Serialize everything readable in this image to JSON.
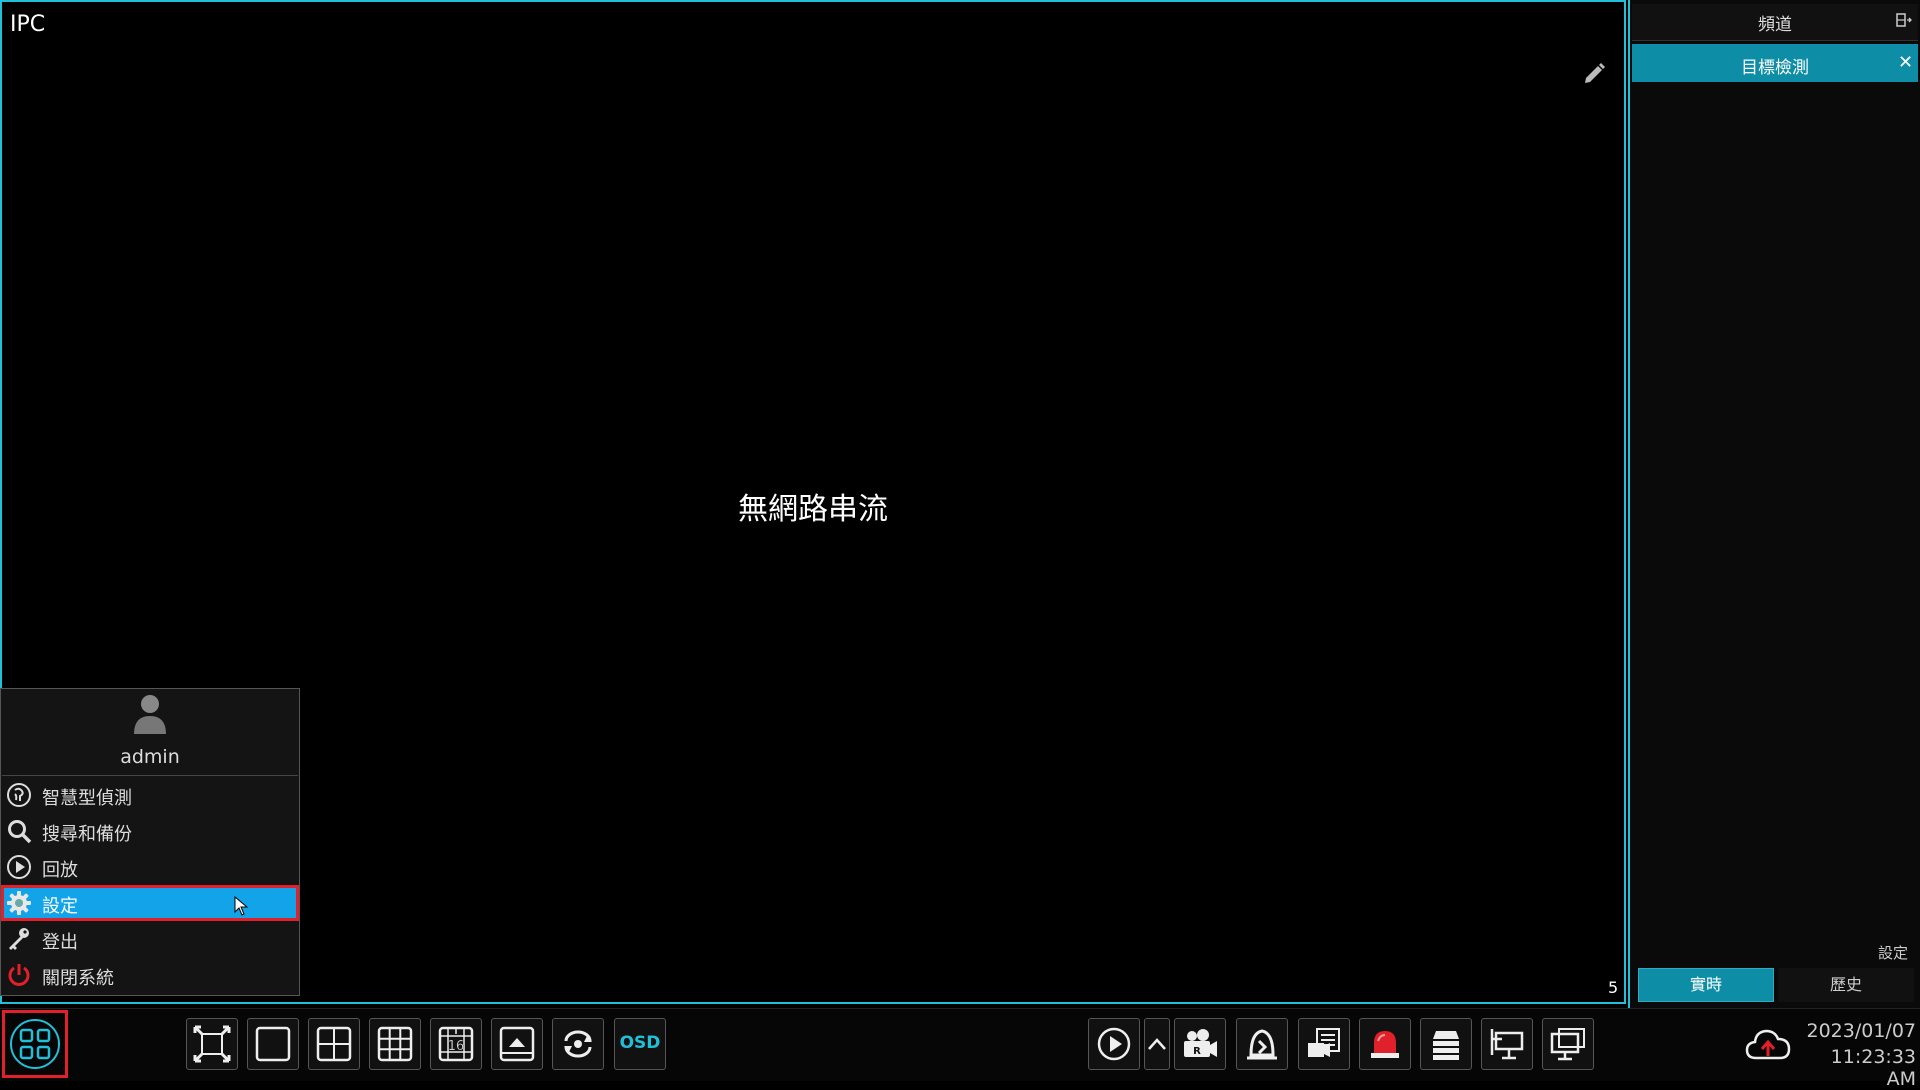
{
  "video": {
    "channel_name": "IPC",
    "status_text": "無網路串流",
    "channel_number": "5"
  },
  "right_panel": {
    "title": "頻道",
    "active_tab": "目標檢測",
    "close_symbol": "✕",
    "settings_link": "設定",
    "live_button": "實時",
    "history_button": "歷史"
  },
  "start_menu": {
    "user": "admin",
    "items": [
      {
        "label": "智慧型偵測",
        "icon": "smart-detection-icon"
      },
      {
        "label": "搜尋和備份",
        "icon": "search-icon"
      },
      {
        "label": "回放",
        "icon": "playback-icon"
      },
      {
        "label": "設定",
        "icon": "gear-icon",
        "selected": true
      },
      {
        "label": "登出",
        "icon": "key-icon"
      },
      {
        "label": "關閉系統",
        "icon": "power-icon"
      }
    ]
  },
  "taskbar": {
    "osd_label": "OSD",
    "date": "2023/01/07",
    "time": "11:23:33 AM",
    "left_tools": [
      "fullscreen-icon",
      "layout-1-icon",
      "layout-4-icon",
      "layout-9-icon",
      "layout-16-icon",
      "sequence-icon",
      "rotate-view-icon"
    ],
    "right_tools": [
      "playback-icon",
      "expand-up-icon",
      "record-icon",
      "manual-alarm-icon",
      "ptz-snapshot-icon",
      "alarm-light-icon",
      "disk-icon",
      "network-icon",
      "monitor-icon"
    ]
  },
  "colors": {
    "accent": "#1fc0d8",
    "selection": "#12a3e8",
    "highlight_border": "#e0202a",
    "tab_active": "#0e8ea6"
  }
}
